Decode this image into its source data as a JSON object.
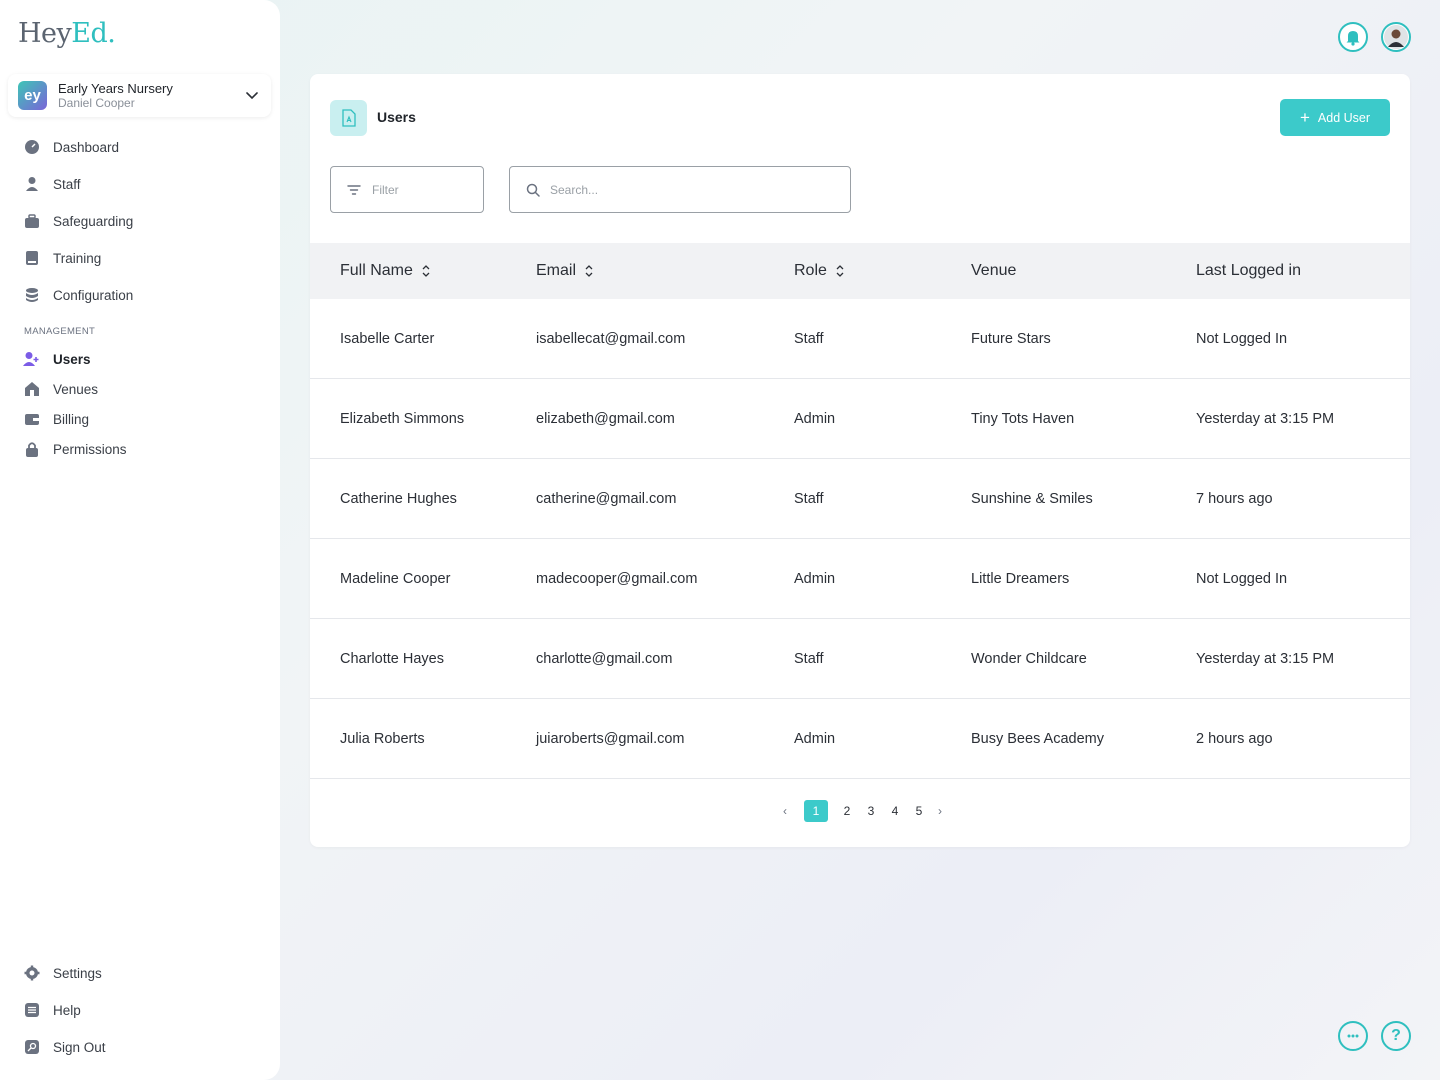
{
  "brand": {
    "logo_main": "Hey",
    "logo_accent": "Ed."
  },
  "org": {
    "avatar_text": "ey",
    "name": "Early Years Nursery",
    "user": "Daniel Cooper"
  },
  "nav": {
    "main": [
      {
        "label": "Dashboard",
        "icon": "dashboard-icon"
      },
      {
        "label": "Staff",
        "icon": "person-icon"
      },
      {
        "label": "Safeguarding",
        "icon": "briefcase-icon"
      },
      {
        "label": "Training",
        "icon": "book-icon"
      },
      {
        "label": "Configuration",
        "icon": "database-icon"
      }
    ],
    "section_label": "MANAGEMENT",
    "management": [
      {
        "label": "Users",
        "icon": "users-icon",
        "active": true
      },
      {
        "label": "Venues",
        "icon": "home-icon"
      },
      {
        "label": "Billing",
        "icon": "wallet-icon"
      },
      {
        "label": "Permissions",
        "icon": "lock-icon"
      }
    ],
    "bottom": [
      {
        "label": "Settings",
        "icon": "gear-icon"
      },
      {
        "label": "Help",
        "icon": "list-icon"
      },
      {
        "label": "Sign Out",
        "icon": "signout-icon"
      }
    ]
  },
  "page": {
    "title": "Users",
    "add_button": "Add User",
    "filter_placeholder": "Filter",
    "search_placeholder": "Search..."
  },
  "table": {
    "headers": [
      "Full Name",
      "Email",
      "Role",
      "Venue",
      "Last Logged in"
    ],
    "rows": [
      {
        "name": "Isabelle Carter",
        "email": "isabellecat@gmail.com",
        "role": "Staff",
        "venue": "Future Stars",
        "last": "Not Logged In"
      },
      {
        "name": "Elizabeth Simmons",
        "email": "elizabeth@gmail.com",
        "role": "Admin",
        "venue": "Tiny Tots Haven",
        "last": "Yesterday at 3:15 PM"
      },
      {
        "name": "Catherine Hughes",
        "email": "catherine@gmail.com",
        "role": "Staff",
        "venue": "Sunshine & Smiles",
        "last": "7 hours ago"
      },
      {
        "name": "Madeline Cooper",
        "email": "madecooper@gmail.com",
        "role": "Admin",
        "venue": "Little Dreamers",
        "last": "Not Logged In"
      },
      {
        "name": "Charlotte Hayes",
        "email": "charlotte@gmail.com",
        "role": "Staff",
        "venue": "Wonder Childcare",
        "last": "Yesterday at 3:15 PM"
      },
      {
        "name": "Julia Roberts",
        "email": "juiaroberts@gmail.com",
        "role": "Admin",
        "venue": "Busy Bees  Academy",
        "last": "2 hours ago"
      }
    ]
  },
  "pagination": {
    "prev": "‹",
    "pages": [
      "1",
      "2",
      "3",
      "4",
      "5"
    ],
    "current": "1",
    "next": "›"
  },
  "help_glyph": "?",
  "colors": {
    "accent": "#3ccaca",
    "brand_teal": "#2fbfbf",
    "active_nav": "#7b5ce6"
  }
}
